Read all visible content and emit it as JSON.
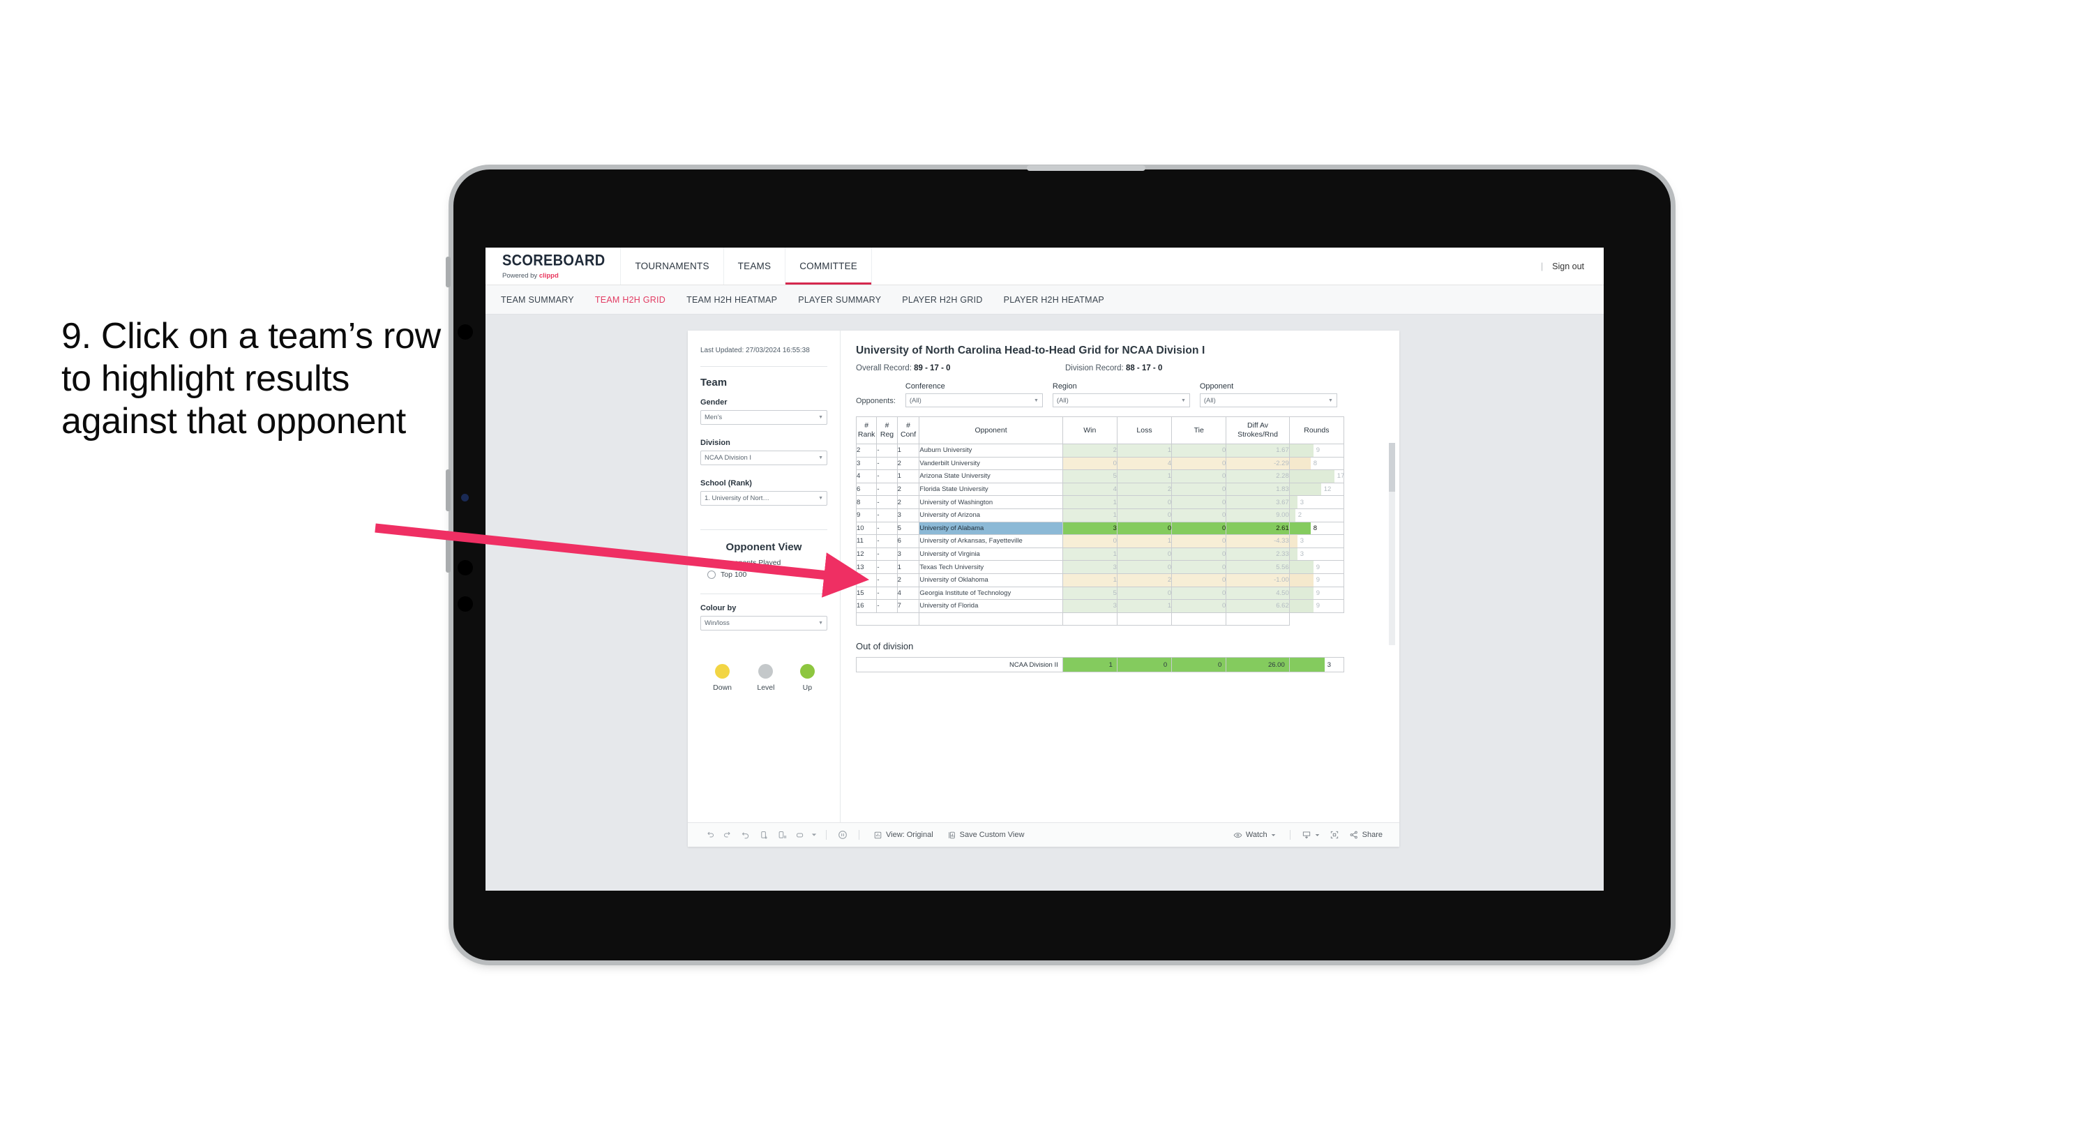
{
  "caption": "9. Click on a team’s row to highlight results against that opponent",
  "brand": {
    "title": "SCOREBOARD",
    "powered_prefix": "Powered by ",
    "powered_name": "clippd"
  },
  "topnav": {
    "items": [
      {
        "label": "TOURNAMENTS",
        "active": false
      },
      {
        "label": "TEAMS",
        "active": false
      },
      {
        "label": "COMMITTEE",
        "active": true
      }
    ],
    "divider": "|",
    "signout": "Sign out"
  },
  "subnav": {
    "items": [
      {
        "label": "TEAM SUMMARY",
        "active": false
      },
      {
        "label": "TEAM H2H GRID",
        "active": true
      },
      {
        "label": "TEAM H2H HEATMAP",
        "active": false
      },
      {
        "label": "PLAYER SUMMARY",
        "active": false
      },
      {
        "label": "PLAYER H2H GRID",
        "active": false
      },
      {
        "label": "PLAYER H2H HEATMAP",
        "active": false
      }
    ]
  },
  "filters": {
    "last_updated": "Last Updated: 27/03/2024 16:55:38",
    "team_heading": "Team",
    "gender": {
      "label": "Gender",
      "value": "Men’s"
    },
    "division": {
      "label": "Division",
      "value": "NCAA Division I"
    },
    "school": {
      "label": "School (Rank)",
      "value": "1. University of Nort…"
    },
    "opponent_view": {
      "heading": "Opponent View",
      "options": [
        {
          "label": "Opponents Played",
          "selected": true
        },
        {
          "label": "Top 100",
          "selected": false
        }
      ]
    },
    "colour_by": {
      "label": "Colour by",
      "value": "Win/loss"
    },
    "legend": [
      {
        "label": "Down",
        "color": "#f2d544"
      },
      {
        "label": "Level",
        "color": "#c4c8ca"
      },
      {
        "label": "Up",
        "color": "#8dc63f"
      }
    ]
  },
  "viz": {
    "title": "University of North Carolina Head-to-Head Grid for NCAA Division I",
    "overall_record_label": "Overall Record:",
    "overall_record_value": "89 - 17 - 0",
    "division_record_label": "Division Record:",
    "division_record_value": "88 - 17 - 0",
    "opponents_label": "Opponents:",
    "opponent_filters": [
      {
        "label": "Conference",
        "value": "(All)"
      },
      {
        "label": "Region",
        "value": "(All)"
      },
      {
        "label": "Opponent",
        "value": "(All)"
      }
    ]
  },
  "chart_data": {
    "type": "table",
    "title": "University of North Carolina Head-to-Head Grid for NCAA Division I",
    "columns": [
      "# Rank",
      "# Reg",
      "# Conf",
      "Opponent",
      "Win",
      "Loss",
      "Tie",
      "Diff Av Strokes/Rnd",
      "Rounds"
    ],
    "rounds_max": 17,
    "rows": [
      {
        "rank": "2",
        "reg": "-",
        "conf": "1",
        "opponent": "Auburn University",
        "win": "2",
        "loss": "1",
        "tie": "0",
        "diff": "1.67",
        "rounds": 9,
        "tone": "up",
        "selected": false
      },
      {
        "rank": "3",
        "reg": "-",
        "conf": "2",
        "opponent": "Vanderbilt University",
        "win": "0",
        "loss": "4",
        "tie": "0",
        "diff": "-2.29",
        "rounds": 8,
        "tone": "down",
        "selected": false
      },
      {
        "rank": "4",
        "reg": "-",
        "conf": "1",
        "opponent": "Arizona State University",
        "win": "5",
        "loss": "1",
        "tie": "0",
        "diff": "2.28",
        "rounds": 17,
        "tone": "up",
        "selected": false
      },
      {
        "rank": "6",
        "reg": "-",
        "conf": "2",
        "opponent": "Florida State University",
        "win": "4",
        "loss": "2",
        "tie": "0",
        "diff": "1.83",
        "rounds": 12,
        "tone": "up",
        "selected": false
      },
      {
        "rank": "8",
        "reg": "-",
        "conf": "2",
        "opponent": "University of Washington",
        "win": "1",
        "loss": "0",
        "tie": "0",
        "diff": "3.67",
        "rounds": 3,
        "tone": "up",
        "selected": false
      },
      {
        "rank": "9",
        "reg": "-",
        "conf": "3",
        "opponent": "University of Arizona",
        "win": "1",
        "loss": "0",
        "tie": "0",
        "diff": "9.00",
        "rounds": 2,
        "tone": "up",
        "selected": false
      },
      {
        "rank": "10",
        "reg": "-",
        "conf": "5",
        "opponent": "University of Alabama",
        "win": "3",
        "loss": "0",
        "tie": "0",
        "diff": "2.61",
        "rounds": 8,
        "tone": "up",
        "selected": true
      },
      {
        "rank": "11",
        "reg": "-",
        "conf": "6",
        "opponent": "University of Arkansas, Fayetteville",
        "win": "0",
        "loss": "1",
        "tie": "0",
        "diff": "-4.33",
        "rounds": 3,
        "tone": "down",
        "selected": false
      },
      {
        "rank": "12",
        "reg": "-",
        "conf": "3",
        "opponent": "University of Virginia",
        "win": "1",
        "loss": "0",
        "tie": "0",
        "diff": "2.33",
        "rounds": 3,
        "tone": "up",
        "selected": false
      },
      {
        "rank": "13",
        "reg": "-",
        "conf": "1",
        "opponent": "Texas Tech University",
        "win": "3",
        "loss": "0",
        "tie": "0",
        "diff": "5.56",
        "rounds": 9,
        "tone": "up",
        "selected": false
      },
      {
        "rank": "14",
        "reg": "-",
        "conf": "2",
        "opponent": "University of Oklahoma",
        "win": "1",
        "loss": "2",
        "tie": "0",
        "diff": "-1.00",
        "rounds": 9,
        "tone": "down",
        "selected": false
      },
      {
        "rank": "15",
        "reg": "-",
        "conf": "4",
        "opponent": "Georgia Institute of Technology",
        "win": "5",
        "loss": "0",
        "tie": "0",
        "diff": "4.50",
        "rounds": 9,
        "tone": "up",
        "selected": false
      },
      {
        "rank": "16",
        "reg": "-",
        "conf": "7",
        "opponent": "University of Florida",
        "win": "3",
        "loss": "1",
        "tie": "0",
        "diff": "6.62",
        "rounds": 9,
        "tone": "up",
        "selected": false
      }
    ],
    "out_of_division": {
      "heading": "Out of division",
      "name": "NCAA Division II",
      "win": "1",
      "loss": "0",
      "tie": "0",
      "diff": "26.00",
      "rounds": "3"
    }
  },
  "toolbar": {
    "view_original": "View: Original",
    "save_custom_view": "Save Custom View",
    "watch": "Watch",
    "share": "Share"
  }
}
